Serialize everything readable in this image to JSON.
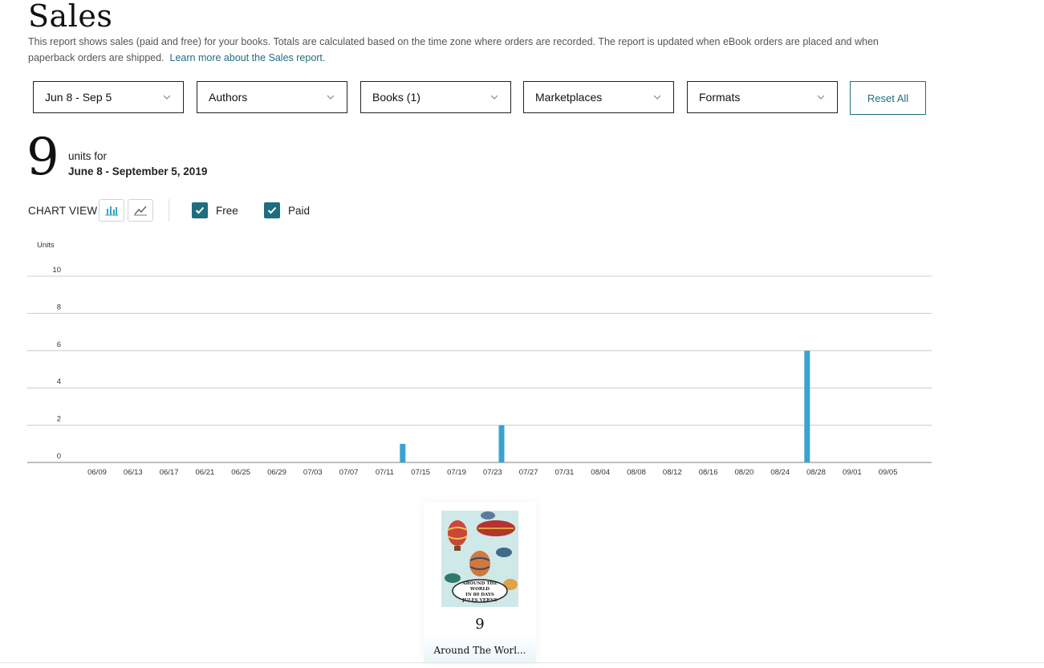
{
  "header": {
    "title": "Sales",
    "description": "This report shows sales (paid and free) for your books. Totals are calculated based on the time zone where orders are recorded. The report is updated when eBook orders are placed and when paperback orders are shipped.",
    "learn_more": "Learn more about the Sales report."
  },
  "filters": [
    {
      "label": "Jun 8 - Sep 5",
      "icon": "chevron-down-icon"
    },
    {
      "label": "Authors",
      "icon": "chevron-down-icon"
    },
    {
      "label": "Books (1)",
      "icon": "chevron-down-icon"
    },
    {
      "label": "Marketplaces",
      "icon": "chevron-down-icon"
    },
    {
      "label": "Formats",
      "icon": "chevron-down-icon"
    }
  ],
  "reset_label": "Reset All",
  "summary": {
    "total": "9",
    "units_for": "units for",
    "date_range": "June 8 - September 5, 2019"
  },
  "chart_controls": {
    "label": "CHART VIEW",
    "bar_view_icon": "bar-chart-icon",
    "line_view_icon": "line-chart-icon",
    "free_label": "Free",
    "paid_label": "Paid",
    "free_checked": true,
    "paid_checked": true
  },
  "colors": {
    "accent": "#1f6e80",
    "bar": "#3aa3d0",
    "gridline": "#cccccc"
  },
  "chart_data": {
    "type": "bar",
    "ylabel": "Units",
    "ylim": [
      0,
      10
    ],
    "yticks": [
      0,
      2,
      4,
      6,
      8,
      10
    ],
    "grid": true,
    "x_start": "06/08",
    "x_end": "09/05",
    "xticks": [
      "06/09",
      "06/13",
      "06/17",
      "06/21",
      "06/25",
      "06/29",
      "07/03",
      "07/07",
      "07/11",
      "07/15",
      "07/19",
      "07/23",
      "07/27",
      "07/31",
      "08/04",
      "08/08",
      "08/12",
      "08/16",
      "08/20",
      "08/24",
      "08/28",
      "09/01",
      "09/05"
    ],
    "bars": [
      {
        "date": "07/13",
        "value": 1
      },
      {
        "date": "07/24",
        "value": 2
      },
      {
        "date": "08/27",
        "value": 6
      }
    ]
  },
  "books": [
    {
      "title": "Around The Worl...",
      "units": "9",
      "cover_text": [
        "AROUND THE",
        "WORLD",
        "IN 80 DAYS",
        "JULES VERNE"
      ]
    }
  ]
}
